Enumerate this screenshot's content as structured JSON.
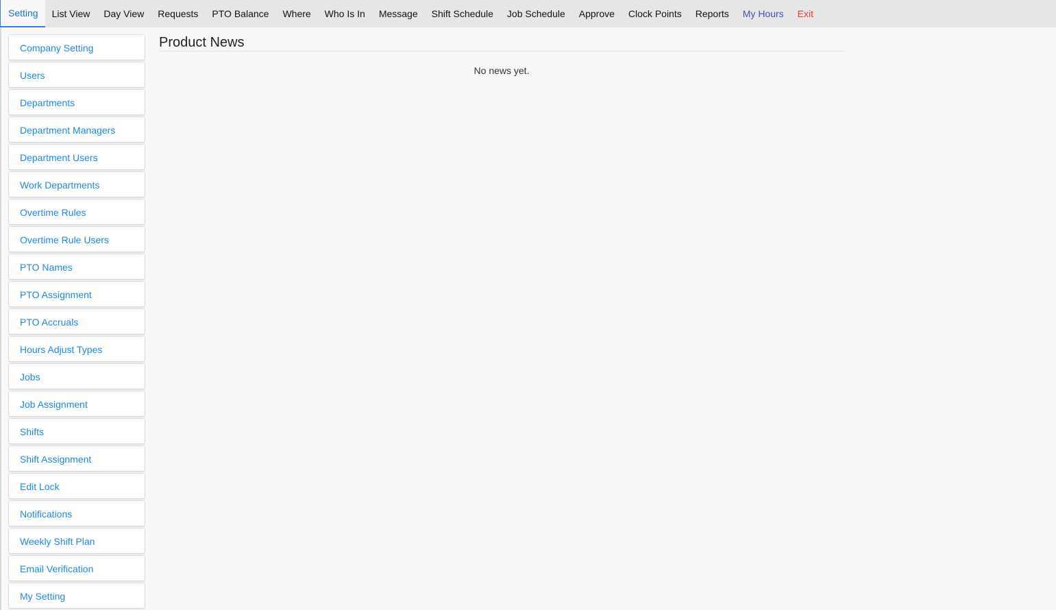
{
  "nav": {
    "tabs": [
      {
        "label": "Setting"
      },
      {
        "label": "List View"
      },
      {
        "label": "Day View"
      },
      {
        "label": "Requests"
      },
      {
        "label": "PTO Balance"
      },
      {
        "label": "Where"
      },
      {
        "label": "Who Is In"
      },
      {
        "label": "Message"
      },
      {
        "label": "Shift Schedule"
      },
      {
        "label": "Job Schedule"
      },
      {
        "label": "Approve"
      },
      {
        "label": "Clock Points"
      },
      {
        "label": "Reports"
      },
      {
        "label": "My Hours"
      },
      {
        "label": "Exit"
      }
    ],
    "active": "Setting",
    "colors": {
      "active": "#1a73d9",
      "my_hours": "#3f51b5",
      "exit": "#e53935"
    }
  },
  "sidebar": {
    "items": [
      {
        "label": "Company Setting"
      },
      {
        "label": "Users"
      },
      {
        "label": "Departments"
      },
      {
        "label": "Department Managers"
      },
      {
        "label": "Department Users"
      },
      {
        "label": "Work Departments"
      },
      {
        "label": "Overtime Rules"
      },
      {
        "label": "Overtime Rule Users"
      },
      {
        "label": "PTO Names"
      },
      {
        "label": "PTO Assignment"
      },
      {
        "label": "PTO Accruals"
      },
      {
        "label": "Hours Adjust Types"
      },
      {
        "label": "Jobs"
      },
      {
        "label": "Job Assignment"
      },
      {
        "label": "Shifts"
      },
      {
        "label": "Shift Assignment"
      },
      {
        "label": "Edit Lock"
      },
      {
        "label": "Notifications"
      },
      {
        "label": "Weekly Shift Plan"
      },
      {
        "label": "Email Verification"
      },
      {
        "label": "My Setting"
      }
    ],
    "link_color": "#1e88e5"
  },
  "main": {
    "title": "Product News",
    "empty_message": "No news yet."
  }
}
